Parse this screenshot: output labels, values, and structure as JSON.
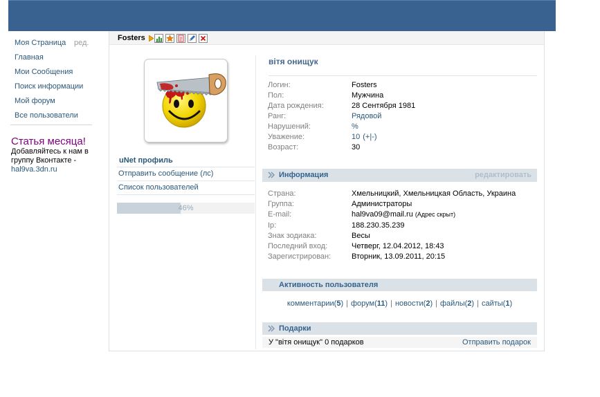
{
  "colors": {
    "header": "#3a6290",
    "link": "#2b587a",
    "title": "#45688e",
    "section": "#dae2e8",
    "promo": "#800080",
    "label": "#7f7f7f"
  },
  "sidebar": {
    "my_page": {
      "label": "Моя Страница",
      "edit": "ред."
    },
    "items": [
      {
        "label": "Главная"
      },
      {
        "label": "Мои Сообщения"
      },
      {
        "label": "Поиск информации"
      },
      {
        "label": "Мой форум"
      },
      {
        "label": "Все пользователи"
      }
    ],
    "promo": {
      "title": "Статья месяца!",
      "lines": [
        "Добавляйтесь к нам в",
        "группу Вконтакте -"
      ],
      "link": "hal9va.3dn.ru"
    }
  },
  "profile_bar": {
    "username": "Fosters",
    "icons": [
      "arrow-icon",
      "chart-icon",
      "star-icon",
      "page-icon",
      "pencil-icon",
      "delete-icon"
    ]
  },
  "left_column": {
    "avatar_icon": "saw-smiley-avatar",
    "title": "uNet профиль",
    "links": [
      {
        "label": "Отправить сообщение (лс)"
      },
      {
        "label": "Список пользователей"
      }
    ],
    "progress": {
      "value": 46,
      "label": "46%"
    }
  },
  "main": {
    "name": "вітя онищук",
    "basic_fields": [
      {
        "label": "Логин:",
        "value": "Fosters"
      },
      {
        "label": "Пол:",
        "value": "Мужчина"
      },
      {
        "label": "Дата рождения:",
        "value": "28 Сентября 1981"
      },
      {
        "label": "Ранг:",
        "value": "Рядовой",
        "link": true
      },
      {
        "label": "Нарушений:",
        "value": "%",
        "link": true
      },
      {
        "label": "Уважение:",
        "value": "10",
        "link": true,
        "vote": {
          "open": "(",
          "plus": "+",
          "sep": "|",
          "minus": "-",
          "close": ")"
        }
      },
      {
        "label": "Возраст:",
        "value": "30"
      }
    ],
    "info": {
      "title": "Информация",
      "edit": "редактировать",
      "fields": [
        {
          "label": "Страна:",
          "value": "Хмельницкий, Хмельницкая Область, Украина"
        },
        {
          "label": "Группа:",
          "value": "Администраторы"
        },
        {
          "label": "E-mail:",
          "value": "hal9va09@mail.ru",
          "note": "(Адрес скрыт)"
        },
        {
          "label": "Ip:",
          "value": "188.230.35.239"
        },
        {
          "label": "Знак зодиака:",
          "value": "Весы"
        },
        {
          "label": "Последний вход:",
          "value": "Четверг, 12.04.2012, 18:43"
        },
        {
          "label": "Зарегистрирован:",
          "value": "Вторник, 13.09.2011, 20:15"
        }
      ]
    },
    "activity": {
      "title": "Активность пользователя",
      "separator": "|",
      "open": "(",
      "close": ")",
      "links": [
        {
          "label": "комментарии",
          "count": "5"
        },
        {
          "label": "форум",
          "count": "11"
        },
        {
          "label": "новости",
          "count": "2"
        },
        {
          "label": "файлы",
          "count": "2"
        },
        {
          "label": "сайты",
          "count": "1"
        }
      ]
    },
    "gifts": {
      "title": "Подарки",
      "summary": "У \"вітя онищук\" 0 подарков",
      "send": "Отправить подарок"
    }
  }
}
